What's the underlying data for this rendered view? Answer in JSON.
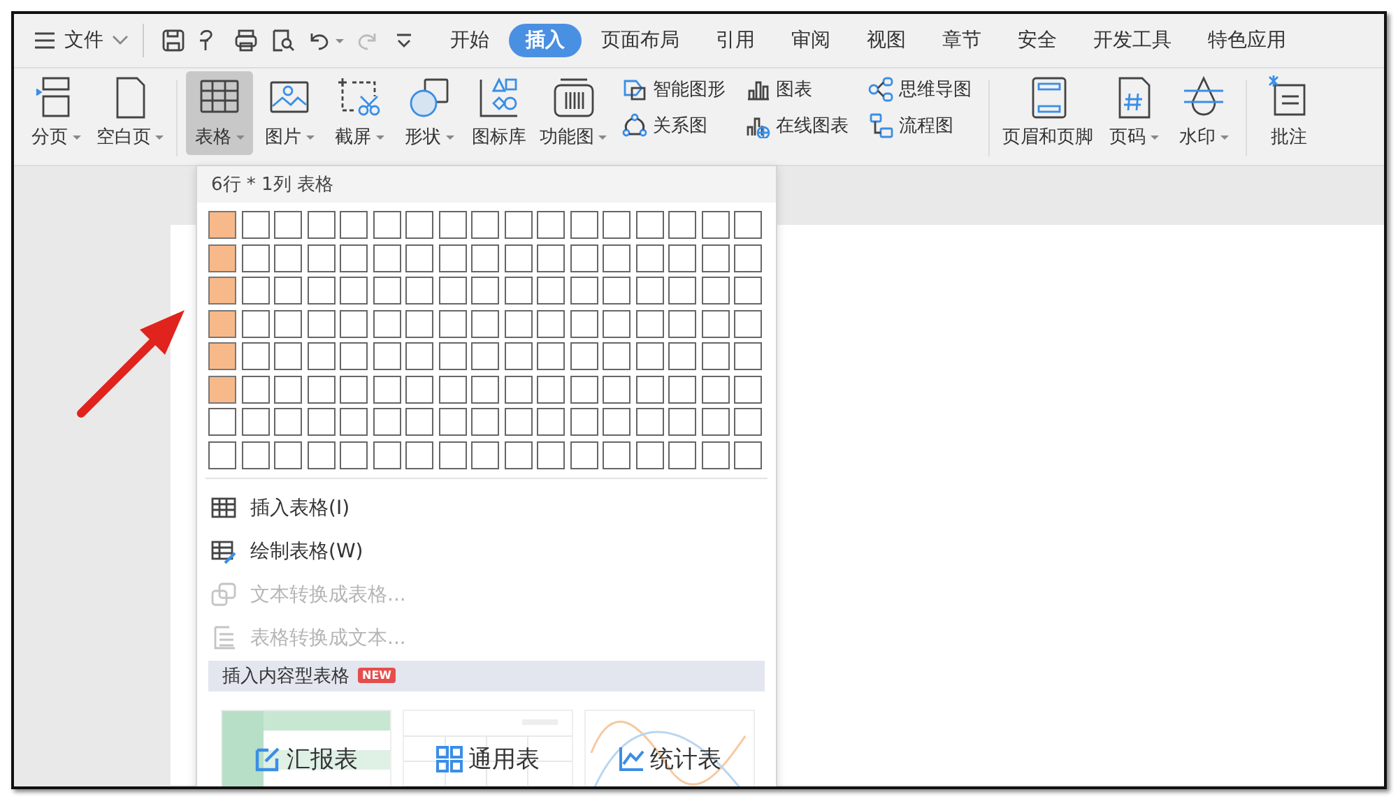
{
  "top_bar": {
    "file_menu": "文件",
    "quick_access": [
      {
        "disabled": false
      },
      {
        "disabled": false
      },
      {
        "disabled": false
      },
      {
        "disabled": false
      },
      {
        "disabled": false
      },
      {
        "disabled": true
      },
      {
        "disabled": false
      }
    ],
    "tabs": [
      {
        "label": "开始",
        "selected": false
      },
      {
        "label": "插入",
        "selected": true
      },
      {
        "label": "页面布局",
        "selected": false
      },
      {
        "label": "引用",
        "selected": false
      },
      {
        "label": "审阅",
        "selected": false
      },
      {
        "label": "视图",
        "selected": false
      },
      {
        "label": "章节",
        "selected": false
      },
      {
        "label": "安全",
        "selected": false
      },
      {
        "label": "开发工具",
        "selected": false
      },
      {
        "label": "特色应用",
        "selected": false
      }
    ]
  },
  "ribbon": {
    "groups": [
      {
        "items": [
          {
            "kind": "large",
            "label": "分页",
            "dropdown": true,
            "selected": false
          },
          {
            "kind": "large",
            "label": "空白页",
            "dropdown": true,
            "selected": false
          }
        ]
      },
      {
        "items": [
          {
            "kind": "large",
            "label": "表格",
            "dropdown": true,
            "selected": true
          },
          {
            "kind": "large",
            "label": "图片",
            "dropdown": true,
            "selected": false
          },
          {
            "kind": "large",
            "label": "截屏",
            "dropdown": true,
            "selected": false
          },
          {
            "kind": "large",
            "label": "形状",
            "dropdown": true,
            "selected": false
          },
          {
            "kind": "large",
            "label": "图标库",
            "dropdown": false,
            "selected": false
          },
          {
            "kind": "large",
            "label": "功能图",
            "dropdown": true,
            "selected": false
          },
          {
            "kind": "stack",
            "items": [
              {
                "label": "智能图形"
              },
              {
                "label": "关系图"
              }
            ]
          },
          {
            "kind": "stack",
            "items": [
              {
                "label": "图表"
              },
              {
                "label": "在线图表"
              }
            ]
          },
          {
            "kind": "stack",
            "items": [
              {
                "label": "思维导图"
              },
              {
                "label": "流程图"
              }
            ]
          }
        ]
      },
      {
        "items": [
          {
            "kind": "large",
            "label": "页眉和页脚",
            "dropdown": false,
            "selected": false
          },
          {
            "kind": "large",
            "label": "页码",
            "dropdown": true,
            "selected": false
          },
          {
            "kind": "large",
            "label": "水印",
            "dropdown": true,
            "selected": false
          }
        ]
      },
      {
        "items": [
          {
            "kind": "large",
            "label": "批注",
            "dropdown": false,
            "selected": false
          }
        ]
      }
    ]
  },
  "table_menu": {
    "header": "6行 * 1列 表格",
    "grid": [
      {
        "cells": [
          {
            "selected": true
          },
          {
            "selected": false
          },
          {
            "selected": false
          },
          {
            "selected": false
          },
          {
            "selected": false
          },
          {
            "selected": false
          },
          {
            "selected": false
          },
          {
            "selected": false
          },
          {
            "selected": false
          },
          {
            "selected": false
          },
          {
            "selected": false
          },
          {
            "selected": false
          },
          {
            "selected": false
          },
          {
            "selected": false
          },
          {
            "selected": false
          },
          {
            "selected": false
          },
          {
            "selected": false
          }
        ]
      },
      {
        "cells": [
          {
            "selected": true
          },
          {
            "selected": false
          },
          {
            "selected": false
          },
          {
            "selected": false
          },
          {
            "selected": false
          },
          {
            "selected": false
          },
          {
            "selected": false
          },
          {
            "selected": false
          },
          {
            "selected": false
          },
          {
            "selected": false
          },
          {
            "selected": false
          },
          {
            "selected": false
          },
          {
            "selected": false
          },
          {
            "selected": false
          },
          {
            "selected": false
          },
          {
            "selected": false
          },
          {
            "selected": false
          }
        ]
      },
      {
        "cells": [
          {
            "selected": true
          },
          {
            "selected": false
          },
          {
            "selected": false
          },
          {
            "selected": false
          },
          {
            "selected": false
          },
          {
            "selected": false
          },
          {
            "selected": false
          },
          {
            "selected": false
          },
          {
            "selected": false
          },
          {
            "selected": false
          },
          {
            "selected": false
          },
          {
            "selected": false
          },
          {
            "selected": false
          },
          {
            "selected": false
          },
          {
            "selected": false
          },
          {
            "selected": false
          },
          {
            "selected": false
          }
        ]
      },
      {
        "cells": [
          {
            "selected": true
          },
          {
            "selected": false
          },
          {
            "selected": false
          },
          {
            "selected": false
          },
          {
            "selected": false
          },
          {
            "selected": false
          },
          {
            "selected": false
          },
          {
            "selected": false
          },
          {
            "selected": false
          },
          {
            "selected": false
          },
          {
            "selected": false
          },
          {
            "selected": false
          },
          {
            "selected": false
          },
          {
            "selected": false
          },
          {
            "selected": false
          },
          {
            "selected": false
          },
          {
            "selected": false
          }
        ]
      },
      {
        "cells": [
          {
            "selected": true
          },
          {
            "selected": false
          },
          {
            "selected": false
          },
          {
            "selected": false
          },
          {
            "selected": false
          },
          {
            "selected": false
          },
          {
            "selected": false
          },
          {
            "selected": false
          },
          {
            "selected": false
          },
          {
            "selected": false
          },
          {
            "selected": false
          },
          {
            "selected": false
          },
          {
            "selected": false
          },
          {
            "selected": false
          },
          {
            "selected": false
          },
          {
            "selected": false
          },
          {
            "selected": false
          }
        ]
      },
      {
        "cells": [
          {
            "selected": true
          },
          {
            "selected": false
          },
          {
            "selected": false
          },
          {
            "selected": false
          },
          {
            "selected": false
          },
          {
            "selected": false
          },
          {
            "selected": false
          },
          {
            "selected": false
          },
          {
            "selected": false
          },
          {
            "selected": false
          },
          {
            "selected": false
          },
          {
            "selected": false
          },
          {
            "selected": false
          },
          {
            "selected": false
          },
          {
            "selected": false
          },
          {
            "selected": false
          },
          {
            "selected": false
          }
        ]
      },
      {
        "cells": [
          {
            "selected": false
          },
          {
            "selected": false
          },
          {
            "selected": false
          },
          {
            "selected": false
          },
          {
            "selected": false
          },
          {
            "selected": false
          },
          {
            "selected": false
          },
          {
            "selected": false
          },
          {
            "selected": false
          },
          {
            "selected": false
          },
          {
            "selected": false
          },
          {
            "selected": false
          },
          {
            "selected": false
          },
          {
            "selected": false
          },
          {
            "selected": false
          },
          {
            "selected": false
          },
          {
            "selected": false
          }
        ]
      },
      {
        "cells": [
          {
            "selected": false
          },
          {
            "selected": false
          },
          {
            "selected": false
          },
          {
            "selected": false
          },
          {
            "selected": false
          },
          {
            "selected": false
          },
          {
            "selected": false
          },
          {
            "selected": false
          },
          {
            "selected": false
          },
          {
            "selected": false
          },
          {
            "selected": false
          },
          {
            "selected": false
          },
          {
            "selected": false
          },
          {
            "selected": false
          },
          {
            "selected": false
          },
          {
            "selected": false
          },
          {
            "selected": false
          }
        ]
      }
    ],
    "items": [
      {
        "label": "插入表格(I)",
        "disabled": false
      },
      {
        "label": "绘制表格(W)",
        "disabled": false
      },
      {
        "label": "文本转换成表格...",
        "disabled": true
      },
      {
        "label": "表格转换成文本...",
        "disabled": true
      }
    ],
    "section": {
      "label": "插入内容型表格",
      "badge": "NEW"
    },
    "templates": [
      {
        "label": "汇报表"
      },
      {
        "label": "通用表"
      },
      {
        "label": "统计表"
      }
    ]
  }
}
